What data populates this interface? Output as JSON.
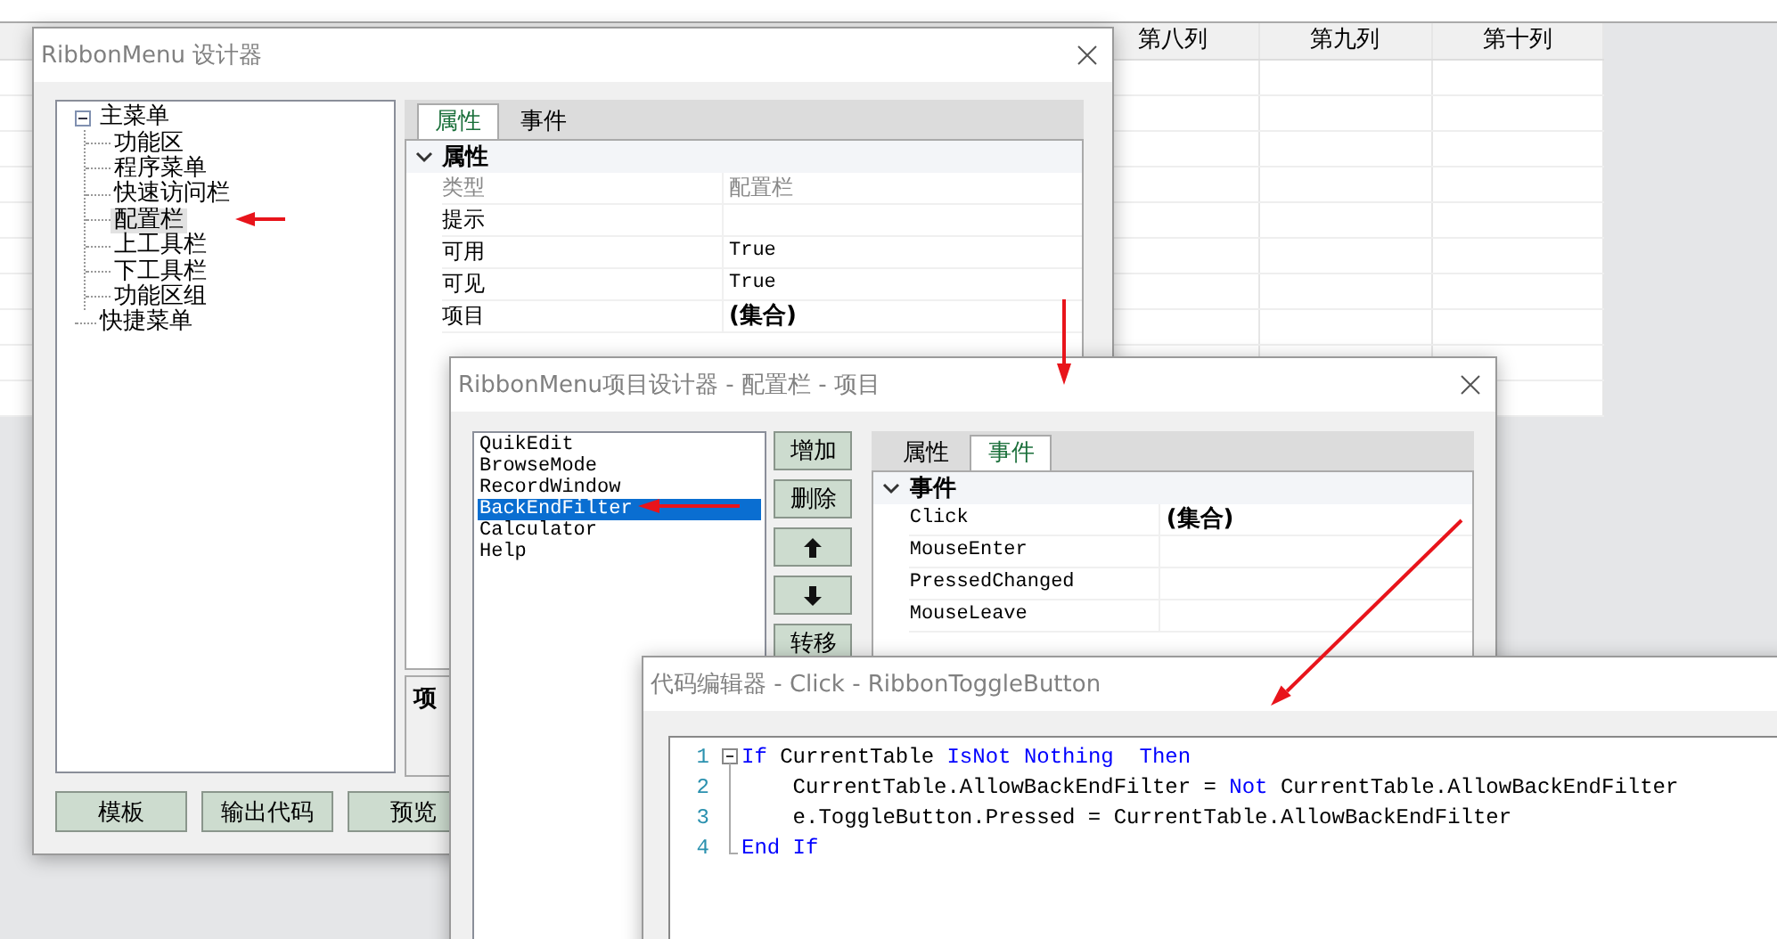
{
  "spreadsheet": {
    "columns": [
      "第八列",
      "第九列",
      "第十列"
    ]
  },
  "designer": {
    "title": "RibbonMenu 设计器",
    "tree": [
      {
        "label": "主菜单",
        "expanded": true,
        "selected": false,
        "children": [
          {
            "label": "功能区",
            "selected": false
          },
          {
            "label": "程序菜单",
            "selected": false
          },
          {
            "label": "快速访问栏",
            "selected": false
          },
          {
            "label": "配置栏",
            "selected": true
          },
          {
            "label": "上工具栏",
            "selected": false
          },
          {
            "label": "下工具栏",
            "selected": false
          },
          {
            "label": "功能区组",
            "selected": false
          }
        ]
      },
      {
        "label": "快捷菜单",
        "selected": false
      }
    ],
    "tabs": [
      {
        "label": "属性",
        "selected": true
      },
      {
        "label": "事件",
        "selected": false
      }
    ],
    "grid": {
      "category": "属性",
      "expanded": true,
      "rows": [
        {
          "name": "类型",
          "value": "配置栏",
          "kind": "text",
          "disabled": true
        },
        {
          "name": "提示",
          "kind": "text",
          "disabled": false
        },
        {
          "name": "可用",
          "value": "True",
          "kind": "mono",
          "disabled": false
        },
        {
          "name": "可见",
          "value": "True",
          "kind": "mono",
          "disabled": false
        },
        {
          "name": "项目",
          "value": "(集合)",
          "kind": "collection",
          "disabled": false
        }
      ]
    },
    "description": {
      "title": "项"
    },
    "buttons": [
      "模板",
      "输出代码",
      "预览"
    ]
  },
  "item_designer": {
    "title": "RibbonMenu项目设计器 - 配置栏 - 项目",
    "items": [
      {
        "label": "QuikEdit",
        "selected": false
      },
      {
        "label": "BrowseMode",
        "selected": false
      },
      {
        "label": "RecordWindow",
        "selected": false
      },
      {
        "label": "BackEndFilter",
        "selected": true
      },
      {
        "label": "Calculator",
        "selected": false
      },
      {
        "label": "Help",
        "selected": false
      }
    ],
    "buttons": [
      {
        "kind": "text",
        "label": "增加"
      },
      {
        "kind": "text",
        "label": "删除"
      },
      {
        "kind": "up"
      },
      {
        "kind": "down"
      },
      {
        "kind": "text",
        "label": "转移"
      }
    ],
    "tabs": [
      {
        "label": "属性",
        "selected": false
      },
      {
        "label": "事件",
        "selected": true
      }
    ],
    "grid": {
      "category": "事件",
      "expanded": true,
      "rows": [
        {
          "name": "Click",
          "value": "(集合)",
          "kind": "collection",
          "disabled": false
        },
        {
          "name": "MouseEnter",
          "kind": "text",
          "disabled": false
        },
        {
          "name": "PressedChanged",
          "kind": "text",
          "disabled": false
        },
        {
          "name": "MouseLeave",
          "kind": "text",
          "disabled": false
        }
      ]
    }
  },
  "code_editor": {
    "title": "代码编辑器 - Click - RibbonToggleButton",
    "fold_expanded": true,
    "lines": [
      {
        "number": "1",
        "segments": [
          {
            "text": "If",
            "kind": "keyword"
          },
          {
            "text": " CurrentTable ",
            "kind": "plain"
          },
          {
            "text": "IsNot Nothing  Then",
            "kind": "keyword"
          }
        ]
      },
      {
        "number": "2",
        "segments": [
          {
            "text": "    CurrentTable.AllowBackEndFilter = ",
            "kind": "plain"
          },
          {
            "text": "Not",
            "kind": "keyword"
          },
          {
            "text": " CurrentTable.AllowBackEndFilter",
            "kind": "plain"
          }
        ]
      },
      {
        "number": "3",
        "segments": [
          {
            "text": "    e.ToggleButton.Pressed = CurrentTable.AllowBackEndFilter",
            "kind": "plain"
          }
        ]
      },
      {
        "number": "4",
        "segments": [
          {
            "text": "End If",
            "kind": "keyword"
          }
        ]
      }
    ]
  }
}
